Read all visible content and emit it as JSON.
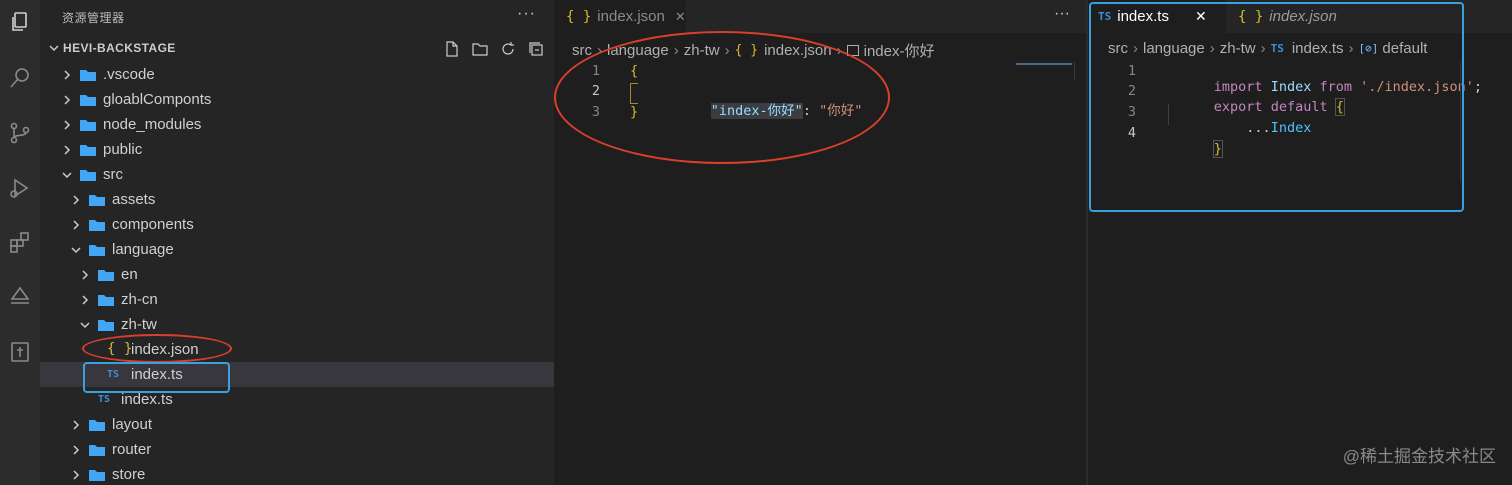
{
  "sidebar": {
    "header": "资源管理器",
    "more": "···",
    "project": "HEVI-BACKSTAGE",
    "tree": [
      {
        "label": ".vscode"
      },
      {
        "label": "gloablComponts"
      },
      {
        "label": "node_modules"
      },
      {
        "label": "public"
      },
      {
        "label": "src"
      },
      {
        "label": "assets"
      },
      {
        "label": "components"
      },
      {
        "label": "language"
      },
      {
        "label": "en"
      },
      {
        "label": "zh-cn"
      },
      {
        "label": "zh-tw"
      },
      {
        "label": "index.json"
      },
      {
        "label": "index.ts"
      },
      {
        "label": "index.ts"
      },
      {
        "label": "layout"
      },
      {
        "label": "router"
      },
      {
        "label": "store"
      }
    ]
  },
  "editor1": {
    "tab": "index.json",
    "more": "···",
    "breadcrumb": [
      "src",
      "language",
      "zh-tw",
      "index.json",
      "index-你好"
    ],
    "lines": [
      {
        "n": "1",
        "tokens": [
          "{"
        ]
      },
      {
        "n": "2",
        "tokens": [
          "\"index-你好\"",
          ": ",
          "\"你好\""
        ]
      },
      {
        "n": "3",
        "tokens": [
          "}"
        ]
      }
    ]
  },
  "editor2": {
    "tabs": [
      "index.ts",
      "index.json"
    ],
    "breadcrumb": [
      "src",
      "language",
      "zh-tw",
      "index.ts",
      "default"
    ],
    "lines": [
      {
        "n": "1",
        "tokens": [
          "import",
          " Index ",
          "from",
          " './index.json'",
          ";"
        ]
      },
      {
        "n": "2",
        "tokens": [
          "export",
          " default ",
          "{"
        ]
      },
      {
        "n": "3",
        "tokens": [
          "    ...",
          "Index"
        ]
      },
      {
        "n": "4",
        "tokens": [
          "}"
        ]
      }
    ]
  },
  "watermark": "@稀土掘金技术社区",
  "colors": {
    "annotation_red": "#d8402c",
    "annotation_blue": "#3aa1e0",
    "keyword": "#c586c0",
    "string": "#ce9178",
    "json_key": "#9cdcfe",
    "identifier": "#4fc1ff"
  }
}
